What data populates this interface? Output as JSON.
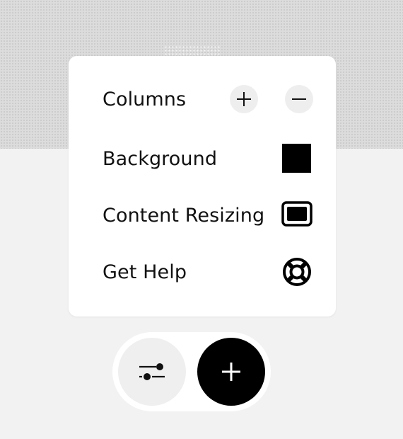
{
  "menu": {
    "items": [
      {
        "label": "Columns",
        "actions": [
          "plus-icon",
          "minus-icon"
        ]
      },
      {
        "label": "Background",
        "swatch_color": "#000000"
      },
      {
        "label": "Content Resizing",
        "icon": "content-resize-icon"
      },
      {
        "label": "Get Help",
        "icon": "lifebuoy-icon"
      }
    ]
  },
  "dock": {
    "settings_icon": "sliders-icon",
    "add_icon": "plus-icon"
  },
  "colors": {
    "canvas_top": "#dcdcdc",
    "canvas_bottom": "#f2f2f2",
    "panel": "#ffffff",
    "text": "#111111",
    "button_bg": "#eeeeee",
    "accent": "#000000"
  }
}
